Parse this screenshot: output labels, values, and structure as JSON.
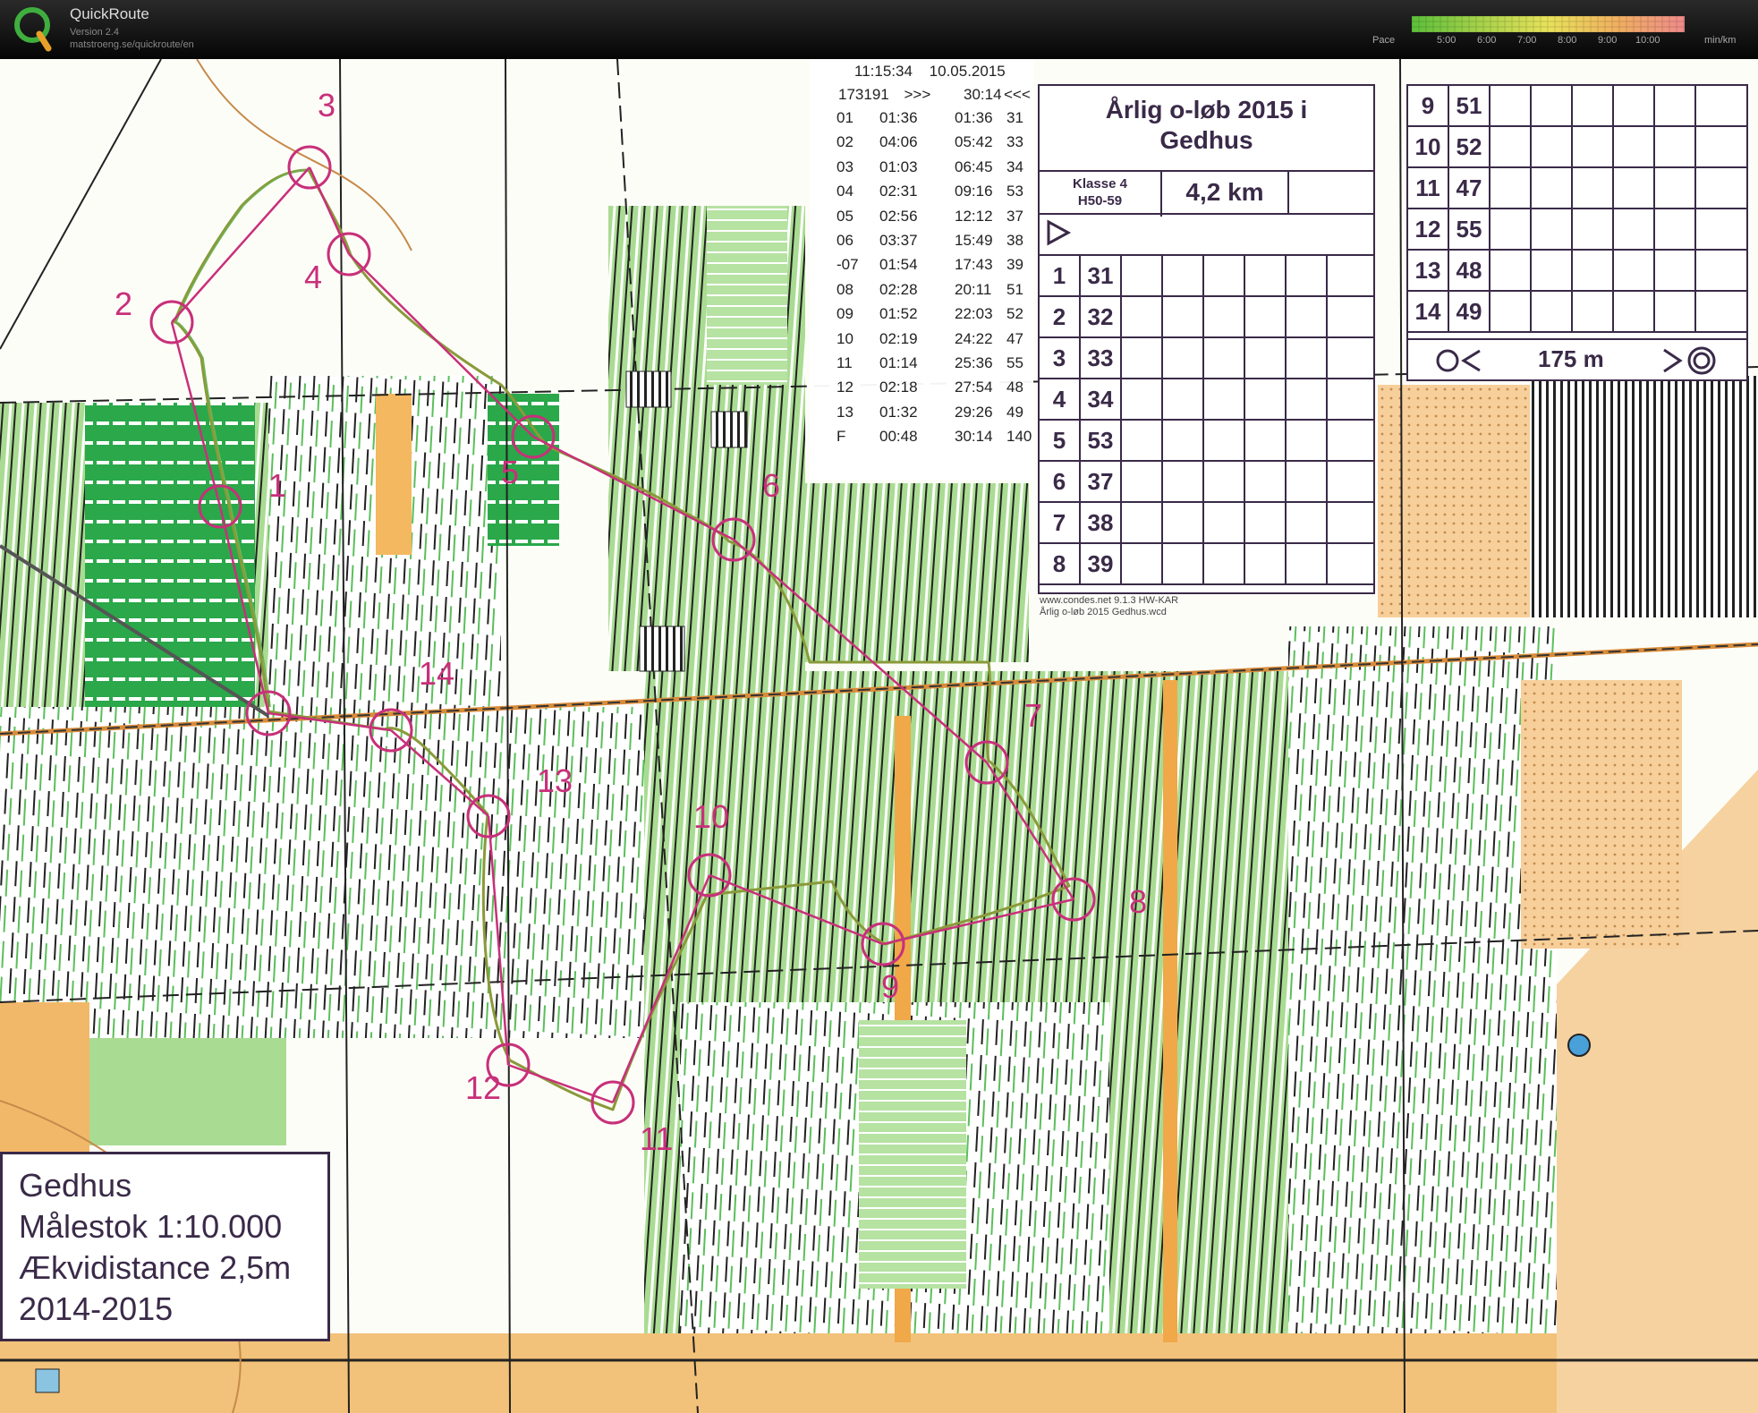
{
  "app": {
    "title": "QuickRoute",
    "version": "Version 2.4",
    "url": "matstroeng.se/quickroute/en",
    "pace_label": "Pace",
    "pace_ticks": [
      "5:00",
      "6:00",
      "7:00",
      "8:00",
      "9:00",
      "10:00"
    ],
    "pace_unit": "min/km",
    "pace_colors": [
      "#5cbf3a",
      "#a6d24a",
      "#e8e25a",
      "#f0b060",
      "#ef8a8a"
    ]
  },
  "splits": {
    "header_time": "11:15:34",
    "header_date": "10.05.2015",
    "runner_id": "173191",
    "total_marker": ">>>",
    "total_time": "30:14",
    "back_marker": "<<<",
    "rows": [
      {
        "ctrl": "01",
        "leg": "01:36",
        "cum": "01:36",
        "code": "31"
      },
      {
        "ctrl": "02",
        "leg": "04:06",
        "cum": "05:42",
        "code": "33"
      },
      {
        "ctrl": "03",
        "leg": "01:03",
        "cum": "06:45",
        "code": "34"
      },
      {
        "ctrl": "04",
        "leg": "02:31",
        "cum": "09:16",
        "code": "53"
      },
      {
        "ctrl": "05",
        "leg": "02:56",
        "cum": "12:12",
        "code": "37"
      },
      {
        "ctrl": "06",
        "leg": "03:37",
        "cum": "15:49",
        "code": "38"
      },
      {
        "ctrl": "-07",
        "leg": "01:54",
        "cum": "17:43",
        "code": "39"
      },
      {
        "ctrl": "08",
        "leg": "02:28",
        "cum": "20:11",
        "code": "51"
      },
      {
        "ctrl": "09",
        "leg": "01:52",
        "cum": "22:03",
        "code": "52"
      },
      {
        "ctrl": "10",
        "leg": "02:19",
        "cum": "24:22",
        "code": "47"
      },
      {
        "ctrl": "11",
        "leg": "01:14",
        "cum": "25:36",
        "code": "55"
      },
      {
        "ctrl": "12",
        "leg": "02:18",
        "cum": "27:54",
        "code": "48"
      },
      {
        "ctrl": "13",
        "leg": "01:32",
        "cum": "29:26",
        "code": "49"
      },
      {
        "ctrl": "F",
        "leg": "00:48",
        "cum": "30:14",
        "code": "140"
      }
    ]
  },
  "description": {
    "title_line1": "Årlig o-løb 2015 i",
    "title_line2": "Gedhus",
    "class_line1": "Klasse 4",
    "class_line2": "H50-59",
    "distance": "4,2 km",
    "rows_left": [
      {
        "n": "1",
        "code": "31"
      },
      {
        "n": "2",
        "code": "32"
      },
      {
        "n": "3",
        "code": "33"
      },
      {
        "n": "4",
        "code": "34"
      },
      {
        "n": "5",
        "code": "53"
      },
      {
        "n": "6",
        "code": "37"
      },
      {
        "n": "7",
        "code": "38"
      },
      {
        "n": "8",
        "code": "39"
      }
    ],
    "rows_right": [
      {
        "n": "9",
        "code": "51"
      },
      {
        "n": "10",
        "code": "52"
      },
      {
        "n": "11",
        "code": "47"
      },
      {
        "n": "12",
        "code": "55"
      },
      {
        "n": "13",
        "code": "48"
      },
      {
        "n": "14",
        "code": "49"
      }
    ],
    "finish_distance": "175 m",
    "footer_line1": "www.condes.net 9.1.3 HW-KAR",
    "footer_line2": "Årlig o-løb 2015 Gedhus.wcd"
  },
  "legend": {
    "line1": "Gedhus",
    "line2": "Målestok 1:10.000",
    "line3": "Ækvidistance 2,5m",
    "line4": "2014-2015"
  },
  "controls": [
    {
      "label": "1"
    },
    {
      "label": "2"
    },
    {
      "label": "3"
    },
    {
      "label": "4"
    },
    {
      "label": "5"
    },
    {
      "label": "6"
    },
    {
      "label": "7"
    },
    {
      "label": "8"
    },
    {
      "label": "9"
    },
    {
      "label": "10"
    },
    {
      "label": "11"
    },
    {
      "label": "12"
    },
    {
      "label": "13"
    },
    {
      "label": "14"
    }
  ],
  "colors": {
    "course": "#c8307a",
    "forest_green": "#9ed88a",
    "dark_green": "#2aa84a",
    "open_yellow": "#f4c27a",
    "path": "#222222"
  }
}
